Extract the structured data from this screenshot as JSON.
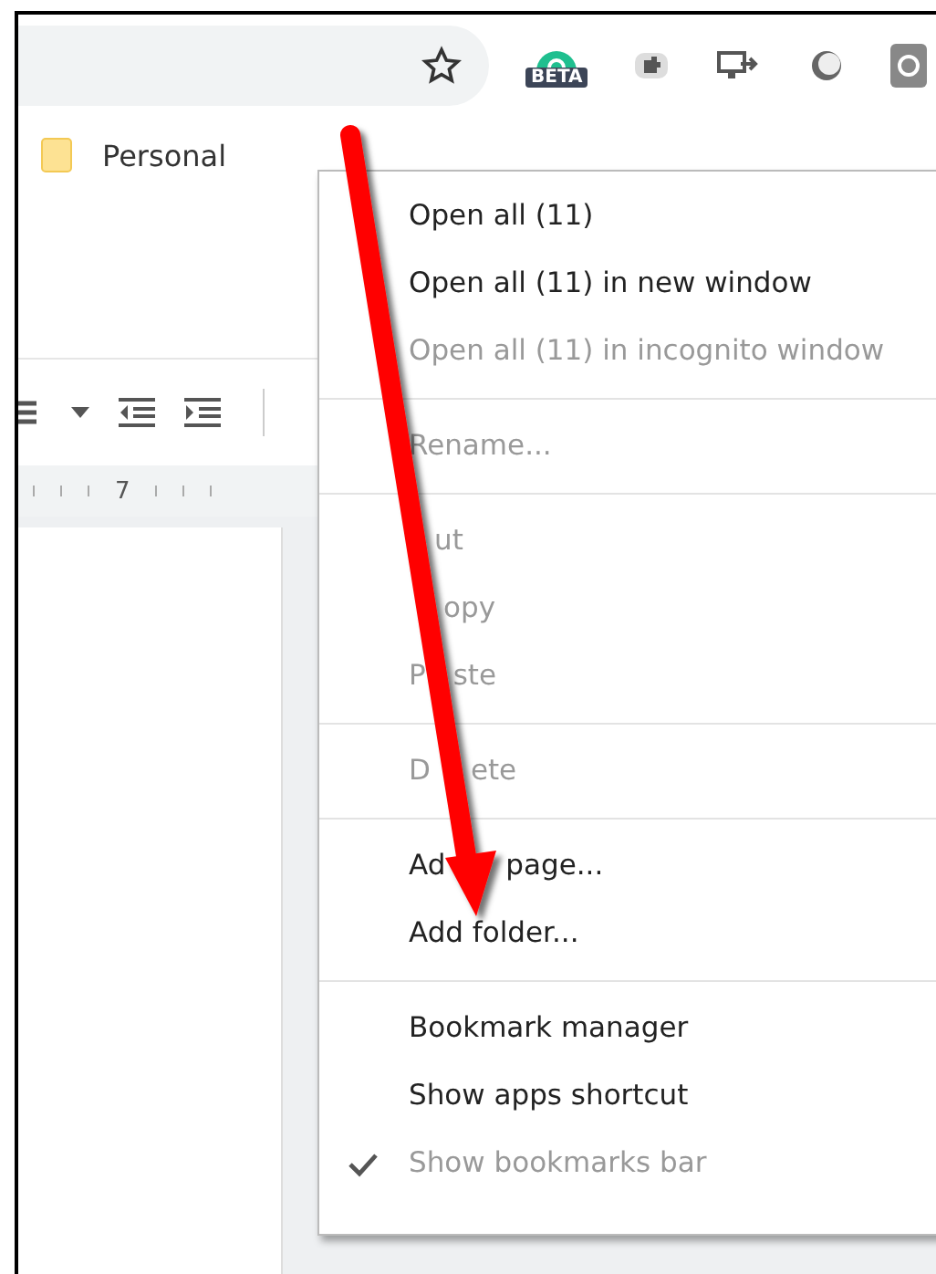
{
  "toolbar": {
    "extensions": [
      {
        "kind": "beta",
        "badge": "BETA"
      },
      {
        "kind": "puzzle"
      },
      {
        "kind": "cast"
      },
      {
        "kind": "circle"
      },
      {
        "kind": "square"
      }
    ]
  },
  "bookmarks_bar": {
    "folders": [
      {
        "label": "Personal"
      }
    ]
  },
  "document": {
    "ruler_mark": "7"
  },
  "menu": {
    "groups": [
      [
        {
          "label": "Open all (11)",
          "disabled": false
        },
        {
          "label": "Open all (11) in new window",
          "disabled": false
        },
        {
          "label": "Open all (11) in incognito window",
          "disabled": true
        }
      ],
      [
        {
          "label": "Rename...",
          "disabled": true
        }
      ],
      [
        {
          "parts": [
            "ut"
          ],
          "disabled": true
        },
        {
          "parts": [
            "opy"
          ],
          "disabled": true
        },
        {
          "parts": [
            "P",
            "ste"
          ],
          "disabled": true
        }
      ],
      [
        {
          "parts": [
            "D",
            "ete"
          ],
          "disabled": true
        }
      ],
      [
        {
          "parts": [
            "Ad",
            "page..."
          ],
          "disabled": false
        },
        {
          "label": "Add folder...",
          "disabled": false
        }
      ],
      [
        {
          "label": "Bookmark manager",
          "disabled": false
        },
        {
          "label": "Show apps shortcut",
          "disabled": false
        },
        {
          "label": "Show bookmarks bar",
          "disabled": true,
          "checked": true
        }
      ]
    ]
  }
}
